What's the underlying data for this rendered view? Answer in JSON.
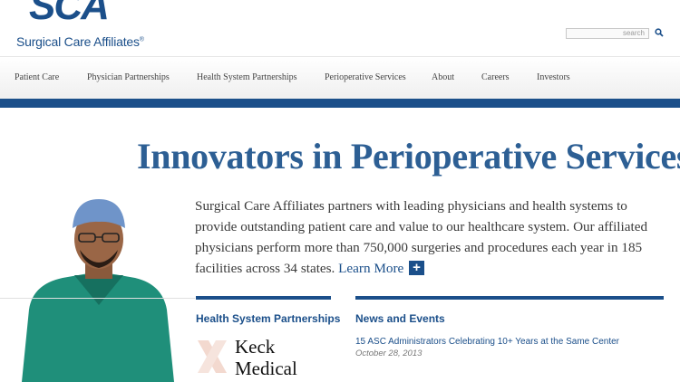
{
  "header": {
    "logo_mark": "SCA",
    "logo_text": "Surgical Care Affiliates",
    "logo_reg": "®",
    "search_placeholder": "search"
  },
  "nav": {
    "items": [
      {
        "label": "Patient Care"
      },
      {
        "label": "Physician Partnerships"
      },
      {
        "label": "Health System Partnerships"
      },
      {
        "label": "Perioperative Services"
      },
      {
        "label": "About"
      },
      {
        "label": "Careers"
      },
      {
        "label": "Investors"
      }
    ]
  },
  "hero": {
    "title": "Innovators in Perioperative Services.",
    "intro": "Surgical Care Affiliates partners with leading physicians and health systems to provide outstanding patient care and value to our healthcare system. Our affiliated physicians perform more than 750,000 surgeries and procedures each year in 185 facilities across 34 states.",
    "learn_more": "Learn More",
    "plus": "+"
  },
  "health_system": {
    "heading": "Health System Partnerships",
    "partner_line1": "Keck",
    "partner_line2": "Medical"
  },
  "news": {
    "heading": "News and Events",
    "items": [
      {
        "title": "15 ASC Administrators Celebrating 10+ Years at the Same Center",
        "date": "October 28, 2013"
      }
    ]
  },
  "colors": {
    "brand_blue": "#1b4f8a",
    "title_blue": "#2d5f94",
    "scrubs_green": "#1f8f7a"
  }
}
